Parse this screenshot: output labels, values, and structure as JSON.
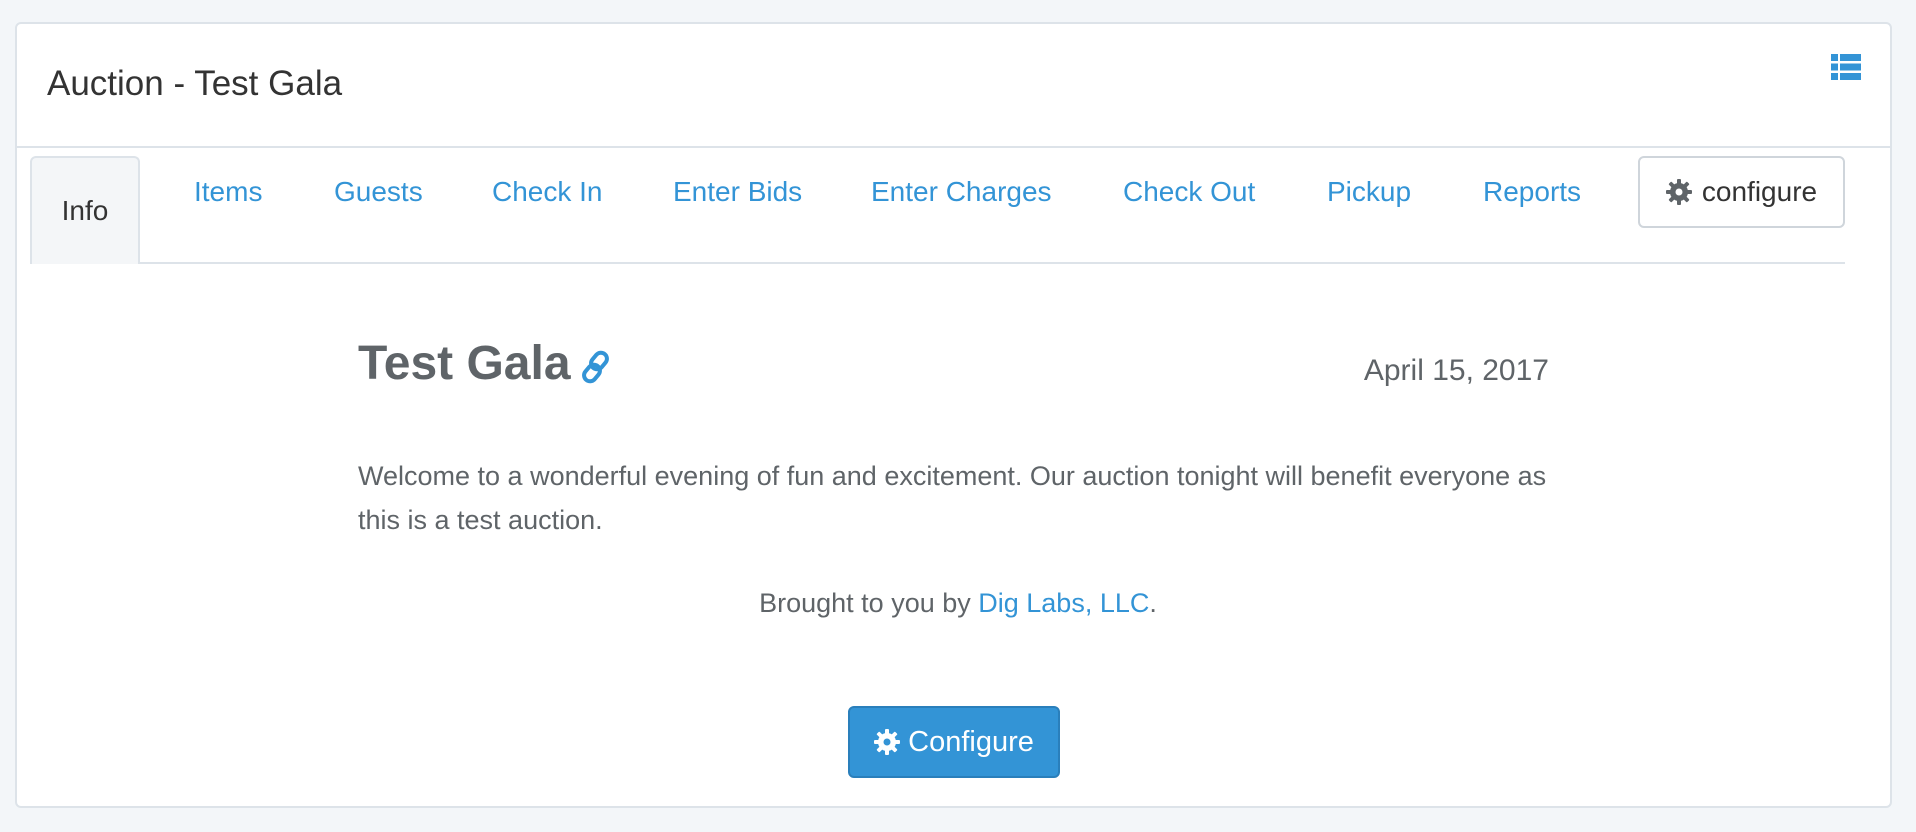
{
  "header": {
    "title": "Auction - Test Gala",
    "menu_icon": "list-icon"
  },
  "tabs": [
    {
      "label": "Info",
      "active": true
    },
    {
      "label": "Items"
    },
    {
      "label": "Guests"
    },
    {
      "label": "Check In"
    },
    {
      "label": "Enter Bids"
    },
    {
      "label": "Enter Charges"
    },
    {
      "label": "Check Out"
    },
    {
      "label": "Pickup"
    },
    {
      "label": "Reports"
    }
  ],
  "tab_configure": {
    "label": "configure",
    "icon": "gear-icon"
  },
  "event": {
    "name": "Test Gala",
    "link_icon": "link-icon",
    "date": "April 15, 2017",
    "description": "Welcome to a wonderful evening of fun and excitement. Our auction tonight will benefit everyone as this is a test auction.",
    "credit_prefix": "Brought to you by ",
    "credit_link": "Dig Labs, LLC",
    "credit_suffix": "."
  },
  "configure_button": {
    "label": "Configure",
    "icon": "gear-icon"
  },
  "colors": {
    "accent": "#3394d6",
    "text": "#5f6468",
    "heading": "#333333",
    "background": "#f3f6f9",
    "border": "#dde3e9"
  }
}
